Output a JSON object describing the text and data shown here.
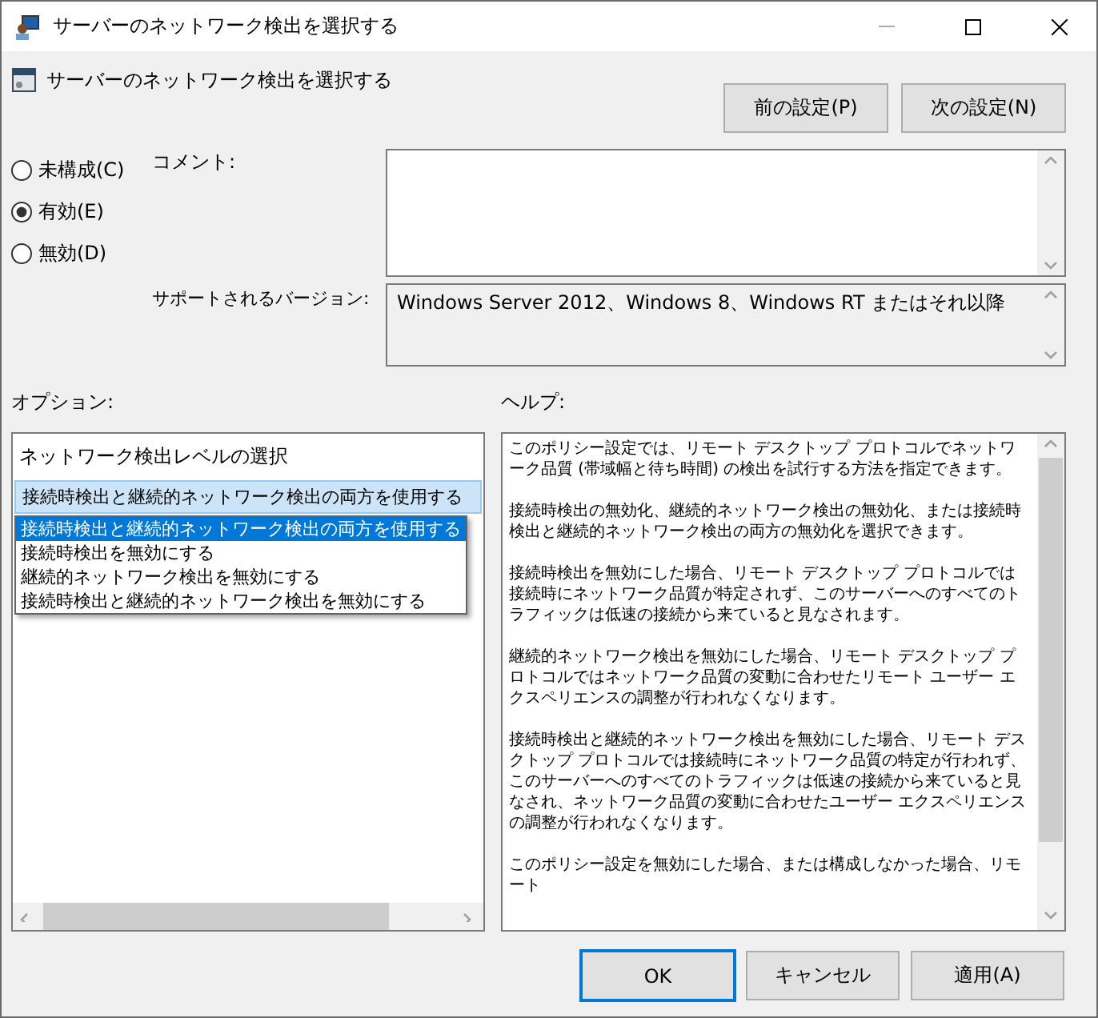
{
  "window": {
    "title": "サーバーのネットワーク検出を選択する"
  },
  "header": {
    "title": "サーバーのネットワーク検出を選択する",
    "buttons": [
      "前の設定(P)",
      "次の設定(N)"
    ]
  },
  "state_options": [
    {
      "label": "未構成(C)",
      "selected": false
    },
    {
      "label": "有効(E)",
      "selected": true
    },
    {
      "label": "無効(D)",
      "selected": false
    }
  ],
  "comment": {
    "label": "コメント:"
  },
  "supported": {
    "label": "サポートされるバージョン:",
    "value": "Windows Server 2012、Windows 8、Windows RT またはそれ以降"
  },
  "options": {
    "label": "オプション:",
    "setting_label": "ネットワーク検出レベルの選択",
    "combo_value": "接続時検出と継続的ネットワーク検出の両方を使用する",
    "dropdown_open": true,
    "dropdown_items": [
      {
        "label": "接続時検出と継続的ネットワーク検出の両方を使用する",
        "selected": true
      },
      {
        "label": "接続時検出を無効にする",
        "selected": false
      },
      {
        "label": "継続的ネットワーク検出を無効にする",
        "selected": false
      },
      {
        "label": "接続時検出と継続的ネットワーク検出を無効にする",
        "selected": false
      }
    ]
  },
  "help": {
    "label": "ヘルプ:",
    "paragraphs": [
      "このポリシー設定では、リモート デスクトップ プロトコルでネットワーク品質 (帯域幅と待ち時間) の検出を試行する方法を指定できます。",
      "接続時検出の無効化、継続的ネットワーク検出の無効化、または接続時検出と継続的ネットワーク検出の両方の無効化を選択できます。",
      "接続時検出を無効にした場合、リモート デスクトップ プロトコルでは接続時にネットワーク品質が特定されず、このサーバーへのすべてのトラフィックは低速の接続から来ていると見なされます。",
      "継続的ネットワーク検出を無効にした場合、リモート デスクトップ プロトコルではネットワーク品質の変動に合わせたリモート ユーザー エクスペリエンスの調整が行われなくなります。",
      "接続時検出と継続的ネットワーク検出を無効にした場合、リモート デスクトップ プロトコルでは接続時にネットワーク品質の特定が行われず、このサーバーへのすべてのトラフィックは低速の接続から来ていると見なされ、ネットワーク品質の変動に合わせたユーザー エクスペリエンスの調整が行われなくなります。",
      "このポリシー設定を無効にした場合、または構成しなかった場合、リモート"
    ]
  },
  "footer": {
    "buttons": [
      {
        "label": "OK",
        "selected": true
      },
      {
        "label": "キャンセル",
        "selected": false
      },
      {
        "label": "適用(A)",
        "selected": false
      }
    ]
  }
}
